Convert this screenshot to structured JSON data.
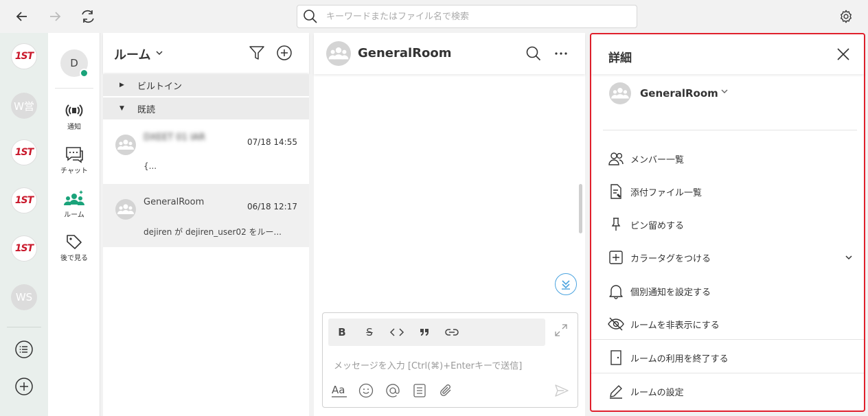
{
  "topbar": {
    "search_placeholder": "キーワードまたはファイル名で検索"
  },
  "rail": {
    "workspaces": [
      {
        "type": "logo",
        "label": "1ST"
      },
      {
        "type": "text",
        "label": "W営"
      },
      {
        "type": "logo",
        "label": "1ST"
      },
      {
        "type": "logo",
        "label": "1ST"
      },
      {
        "type": "logo",
        "label": "1ST"
      },
      {
        "type": "text",
        "label": "WS"
      }
    ],
    "brand_color": "#c9182b"
  },
  "menu": {
    "user_initial": "D",
    "items": [
      {
        "label": "通知",
        "icon": "broadcast-icon"
      },
      {
        "label": "チャット",
        "icon": "chat-icon"
      },
      {
        "label": "ルーム",
        "icon": "room-icon",
        "active": true
      },
      {
        "label": "後で見る",
        "icon": "tag-icon"
      }
    ],
    "accent_color": "#1aa37a"
  },
  "roomlist": {
    "title": "ルーム",
    "groups": [
      {
        "label": "ビルトイン",
        "expanded": false
      },
      {
        "label": "既読",
        "expanded": true
      }
    ],
    "rooms": [
      {
        "name": "DXEET 01 IAR",
        "time": "07/18 14:55",
        "preview": "{...",
        "blurred": true
      },
      {
        "name": "GeneralRoom",
        "time": "06/18 12:17",
        "preview": "dejiren が dejiren_user02 をルー...",
        "blurred": false
      }
    ]
  },
  "chat": {
    "room_name": "GeneralRoom",
    "composer_placeholder": "メッセージを入力 [Ctrl(⌘)+Enterキーで送信]",
    "format_buttons": [
      "B",
      "S",
      "<>",
      "❞",
      "link"
    ]
  },
  "detail": {
    "title": "詳細",
    "room_name": "GeneralRoom",
    "actions": [
      {
        "label": "メンバー一覧",
        "icon": "members-icon"
      },
      {
        "label": "添付ファイル一覧",
        "icon": "attachment-list-icon"
      },
      {
        "label": "ピン留めする",
        "icon": "pin-icon"
      },
      {
        "label": "カラータグをつける",
        "icon": "color-tag-icon",
        "has_chevron": true
      },
      {
        "label": "個別通知を設定する",
        "icon": "bell-icon"
      },
      {
        "label": "ルームを非表示にする",
        "icon": "hide-icon"
      },
      {
        "label": "ルームの利用を終了する",
        "icon": "exit-door-icon"
      },
      {
        "label": "ルームの設定",
        "icon": "edit-pen-icon"
      }
    ],
    "highlight_color": "#e0202c"
  }
}
